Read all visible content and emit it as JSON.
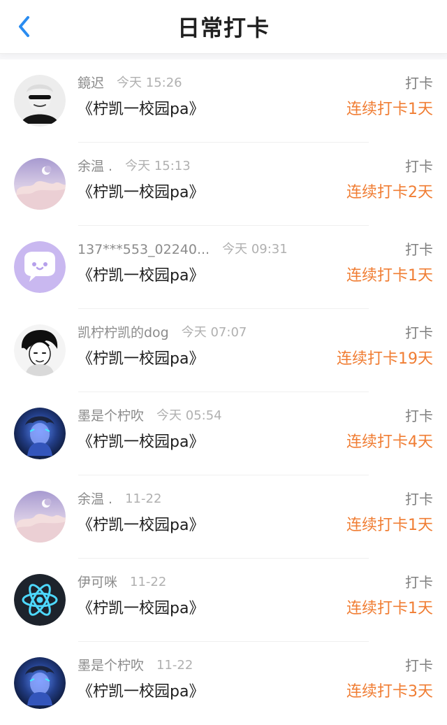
{
  "header": {
    "title": "日常打卡"
  },
  "items": [
    {
      "name": "鏡迟",
      "time": "今天 15:26",
      "content": "《柠凯一校园pa》",
      "action_label": "打卡",
      "streak": "连续打卡1天",
      "avatar": "anime-white-hair-avatar"
    },
    {
      "name": "余温 .",
      "time": "今天 15:13",
      "content": "《柠凯一校园pa》",
      "action_label": "打卡",
      "streak": "连续打卡2天",
      "avatar": "moon-sky-avatar"
    },
    {
      "name": "137***553_02240...",
      "time": "今天 09:31",
      "content": "《柠凯一校园pa》",
      "action_label": "打卡",
      "streak": "连续打卡1天",
      "avatar": "chat-bubble-avatar"
    },
    {
      "name": "凯柠柠凯的dog",
      "time": "今天 07:07",
      "content": "《柠凯一校园pa》",
      "action_label": "打卡",
      "streak": "连续打卡19天",
      "avatar": "black-hair-sketch-avatar"
    },
    {
      "name": "墨是个柠吹",
      "time": "今天 05:54",
      "content": "《柠凯一校园pa》",
      "action_label": "打卡",
      "streak": "连续打卡4天",
      "avatar": "dark-blue-anime-avatar"
    },
    {
      "name": "余温 .",
      "time": "11-22",
      "content": "《柠凯一校园pa》",
      "action_label": "打卡",
      "streak": "连续打卡1天",
      "avatar": "moon-sky-avatar"
    },
    {
      "name": "伊可咪",
      "time": "11-22",
      "content": "《柠凯一校园pa》",
      "action_label": "打卡",
      "streak": "连续打卡1天",
      "avatar": "atom-avatar"
    },
    {
      "name": "墨是个柠吹",
      "time": "11-22",
      "content": "《柠凯一校园pa》",
      "action_label": "打卡",
      "streak": "连续打卡3天",
      "avatar": "dark-blue-anime-avatar"
    }
  ],
  "colors": {
    "accent": "#1E88E5",
    "streak": "#F07D33",
    "muted_text": "#9B9B9B"
  }
}
